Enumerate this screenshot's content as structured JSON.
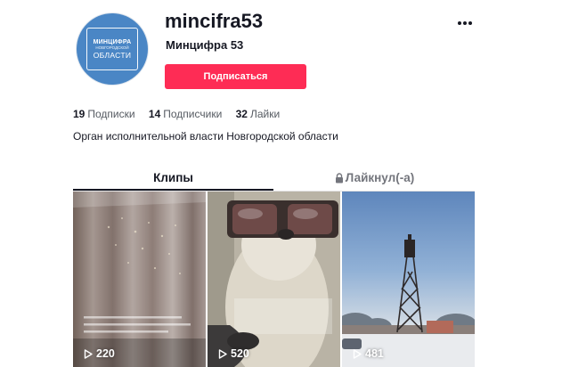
{
  "profile": {
    "username": "mincifra53",
    "nickname": "Минцифра 53",
    "avatar": {
      "line1": "МИНЦИФРА",
      "line2": "НОВГОРОДСКОЙ",
      "line3": "ОБЛАСТИ",
      "color": "#4a86c5"
    },
    "follow_label": "Подписаться",
    "follow_color": "#fe2c55",
    "bio": "Орган исполнительной власти Новгородской области"
  },
  "stats": {
    "following": {
      "count": "19",
      "label": "Подписки"
    },
    "followers": {
      "count": "14",
      "label": "Подписчики"
    },
    "likes": {
      "count": "32",
      "label": "Лайки"
    }
  },
  "tabs": {
    "clips": "Клипы",
    "liked": "Лайкнул(-а)",
    "liked_icon": "lock-icon",
    "active": "clips"
  },
  "menu_icon": "more-dots-icon",
  "videos": [
    {
      "views": "220",
      "icon": "play-icon",
      "scene": "curtains"
    },
    {
      "views": "520",
      "icon": "play-icon",
      "scene": "dog-in-sunglasses"
    },
    {
      "views": "481",
      "icon": "play-icon",
      "scene": "winter-tower"
    }
  ]
}
